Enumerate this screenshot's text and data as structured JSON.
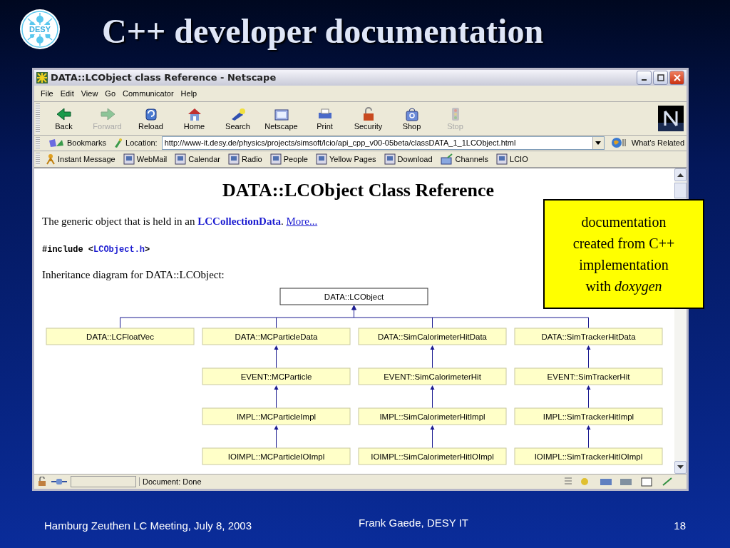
{
  "slide": {
    "title": "C++ developer documentation",
    "logo": "DESY"
  },
  "window": {
    "title": "DATA::LCObject class Reference - Netscape"
  },
  "menu": [
    "File",
    "Edit",
    "View",
    "Go",
    "Communicator",
    "Help"
  ],
  "toolbar": [
    {
      "label": "Back",
      "disabled": false
    },
    {
      "label": "Forward",
      "disabled": true
    },
    {
      "label": "Reload",
      "disabled": false
    },
    {
      "label": "Home",
      "disabled": false
    },
    {
      "label": "Search",
      "disabled": false
    },
    {
      "label": "Netscape",
      "disabled": false
    },
    {
      "label": "Print",
      "disabled": false
    },
    {
      "label": "Security",
      "disabled": false
    },
    {
      "label": "Shop",
      "disabled": false
    },
    {
      "label": "Stop",
      "disabled": true
    }
  ],
  "location_bar": {
    "bookmarks": "Bookmarks",
    "label": "Location:",
    "url": "http://www-it.desy.de/physics/projects/simsoft/lcio/api_cpp_v00-05beta/classDATA_1_1LCObject.html",
    "related": "What's Related"
  },
  "personal_toolbar": [
    "Instant Message",
    "WebMail",
    "Calendar",
    "Radio",
    "People",
    "Yellow Pages",
    "Download",
    "Channels",
    "LCIO"
  ],
  "page": {
    "heading": "DATA::LCObject Class Reference",
    "intro": "The generic object that is held in an",
    "intro_link": "LCCollectionData",
    "intro_end": ".",
    "more_link": "More...",
    "include_prefix": "#include <",
    "include_file": "LCObject.h",
    "include_suffix": ">",
    "diagram_caption": "Inheritance diagram for DATA::LCObject:",
    "diagram": {
      "label": "DATA::LCObject",
      "children": [
        {
          "label": "DATA::LCFloatVec"
        },
        {
          "label": "DATA::MCParticleData",
          "children": [
            {
              "label": "EVENT::MCParticle",
              "children": [
                {
                  "label": "IMPL::MCParticleImpl",
                  "children": [
                    {
                      "label": "IOIMPL::MCParticleIOImpl"
                    }
                  ]
                }
              ]
            }
          ]
        },
        {
          "label": "DATA::SimCalorimeterHitData",
          "children": [
            {
              "label": "EVENT::SimCalorimeterHit",
              "children": [
                {
                  "label": "IMPL::SimCalorimeterHitImpl",
                  "children": [
                    {
                      "label": "IOIMPL::SimCalorimeterHitIOImpl"
                    }
                  ]
                }
              ]
            }
          ]
        },
        {
          "label": "DATA::SimTrackerHitData",
          "children": [
            {
              "label": "EVENT::SimTrackerHit",
              "children": [
                {
                  "label": "IMPL::SimTrackerHitImpl",
                  "children": [
                    {
                      "label": "IOIMPL::SimTrackerHitIOImpl"
                    }
                  ]
                }
              ]
            }
          ]
        }
      ]
    }
  },
  "status_bar": {
    "text": "Document: Done"
  },
  "callout": "documentation created from C++ implementation with *doxygen*",
  "footer": {
    "left": "Hamburg Zeuthen LC Meeting, July 8, 2003",
    "center": "Frank Gaede, DESY IT",
    "page_number": "18"
  }
}
